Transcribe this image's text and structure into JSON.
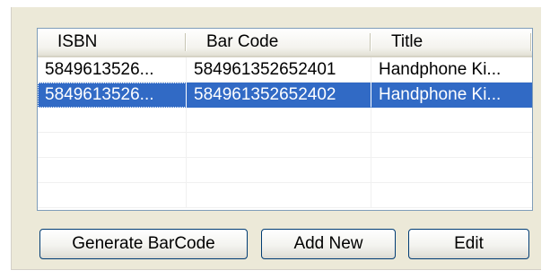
{
  "table": {
    "columns": [
      "ISBN",
      "Bar Code",
      "Title"
    ],
    "rows": [
      {
        "isbn": "5849613526...",
        "barcode": "584961352652401",
        "title": "Handphone Ki...",
        "selected": false
      },
      {
        "isbn": "5849613526...",
        "barcode": "584961352652402",
        "title": "Handphone Ki...",
        "selected": true
      }
    ],
    "empty_rows": 4
  },
  "buttons": {
    "generate_label": "Generate BarCode",
    "add_label": "Add New",
    "edit_label": "Edit"
  },
  "colors": {
    "selection": "#316ac5",
    "panel": "#ece9d8",
    "button_border": "#003c74"
  }
}
